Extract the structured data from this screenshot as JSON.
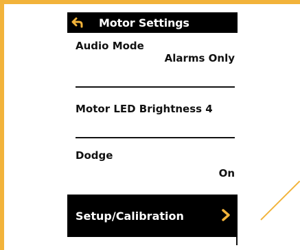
{
  "colors": {
    "accent": "#f2b33a",
    "header_bg": "#000000",
    "text": "#111111",
    "highlight_bg": "#000000",
    "highlight_text": "#ffffff"
  },
  "header": {
    "icon": "back-arrow-icon",
    "title": "Motor Settings"
  },
  "menu": {
    "audio_mode": {
      "label": "Audio Mode",
      "value": "Alarms Only"
    },
    "motor_led": {
      "label": "Motor LED Brightness 4"
    },
    "dodge": {
      "label": "Dodge",
      "value": "On"
    },
    "setup": {
      "label": "Setup/Calibration",
      "icon": "chevron-right-icon"
    }
  }
}
